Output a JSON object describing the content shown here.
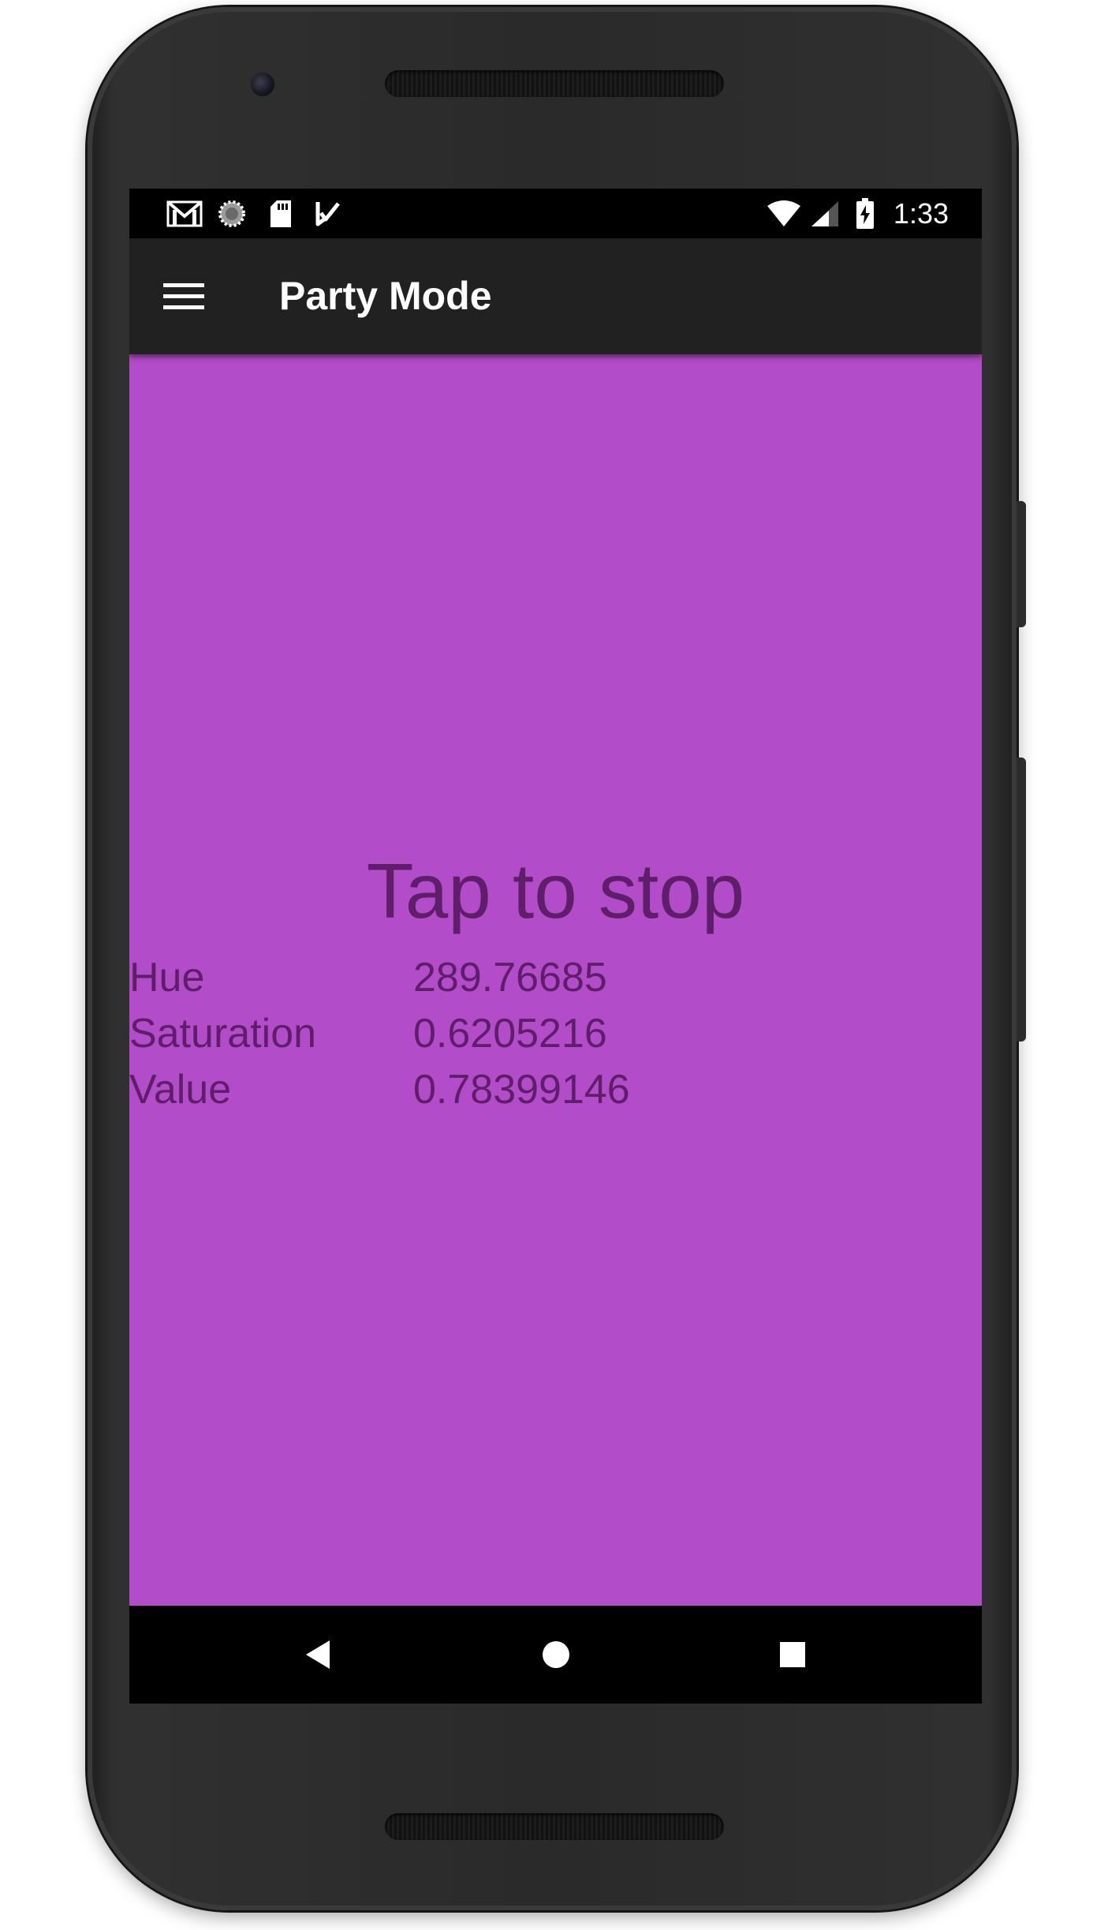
{
  "device": {
    "name": "phone-frame"
  },
  "status_bar": {
    "time": "1:33",
    "left_icons": [
      "gmail-icon",
      "sync-icon",
      "sd-card-icon",
      "task-done-icon"
    ],
    "right_icons": [
      "wifi-icon",
      "cell-signal-icon",
      "battery-charging-icon"
    ]
  },
  "app_bar": {
    "title": "Party Mode",
    "menu_icon": "hamburger-menu-icon"
  },
  "content": {
    "background_color": "#b24cc8",
    "text_color": "#5f1e6a",
    "tap_label": "Tap to stop",
    "hsv": [
      {
        "name": "Hue",
        "value": "289.76685"
      },
      {
        "name": "Saturation",
        "value": "0.6205216"
      },
      {
        "name": "Value",
        "value": "0.78399146"
      }
    ]
  },
  "nav_bar": {
    "back_icon": "back-triangle-icon",
    "home_icon": "home-circle-icon",
    "recents_icon": "recents-square-icon"
  }
}
